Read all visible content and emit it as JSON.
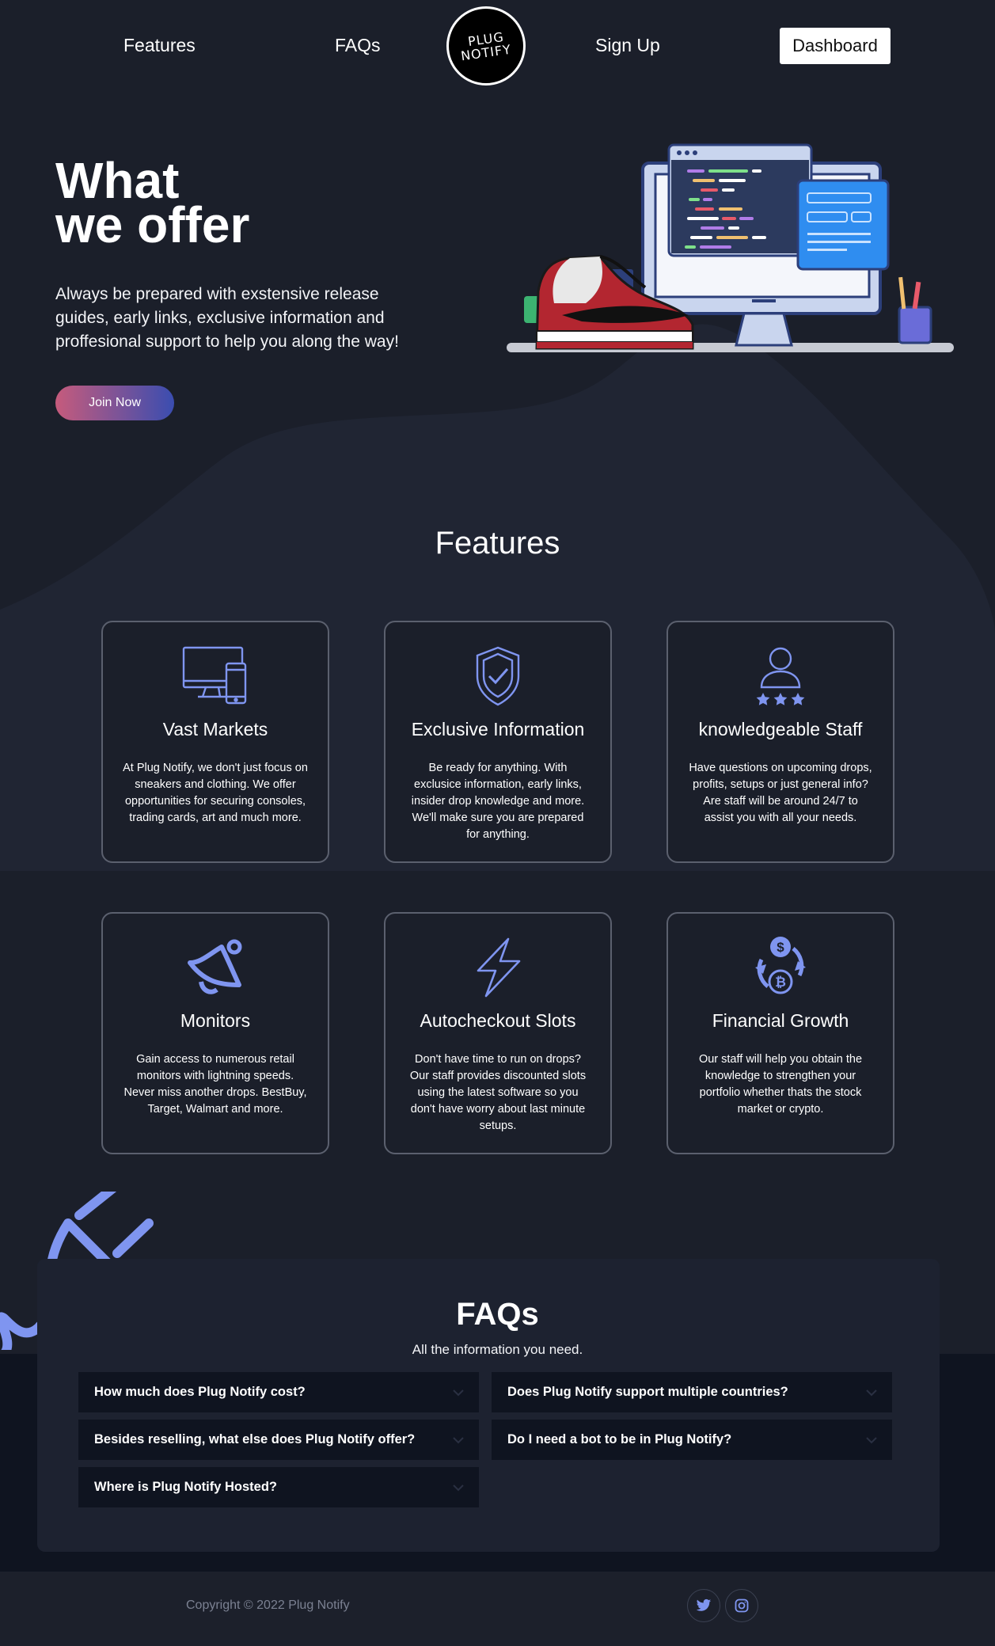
{
  "nav": {
    "features_label": "Features",
    "faqs_label": "FAQs",
    "logo_line1": "PLUG",
    "logo_line2": "NOTIFY",
    "signup_label": "Sign Up",
    "dashboard_label": "Dashboard"
  },
  "hero": {
    "title_line1": "What",
    "title_line2": "we offer",
    "text": "Always be prepared with exstensive release guides, early links, exclusive information and proffesional support to help you along the way!",
    "join_label": "Join Now"
  },
  "features": {
    "title": "Features",
    "cards": [
      {
        "icon": "devices-icon",
        "title": "Vast Markets",
        "text": "At Plug Notify, we don't just focus on sneakers and clothing. We offer opportunities for securing consoles, trading cards, art and much more."
      },
      {
        "icon": "shield-check-icon",
        "title": "Exclusive Information",
        "text": "Be ready for anything. With exclusice information, early links, insider drop knowledge and more. We'll make sure you are prepared for anything."
      },
      {
        "icon": "user-stars-icon",
        "title": "knowledgeable Staff",
        "text": "Have questions on upcoming drops, profits, setups or just general info? Are staff will be around 24/7 to assist you with all your needs."
      },
      {
        "icon": "bell-icon",
        "title": "Monitors",
        "text": "Gain access to numerous retail monitors with lightning speeds. Never miss another drops. BestBuy, Target, Walmart and more."
      },
      {
        "icon": "lightning-icon",
        "title": "Autocheckout Slots",
        "text": "Don't have time to run on drops? Our staff provides discounted slots using the latest software so you don't have worry about last minute setups."
      },
      {
        "icon": "currency-exchange-icon",
        "title": "Financial Growth",
        "text": "Our staff will help you obtain the knowledge to strengthen your portfolio whether thats the stock market or crypto."
      }
    ]
  },
  "faq": {
    "title": "FAQs",
    "subtitle": "All the information you need.",
    "items": [
      {
        "q": "How much does Plug Notify cost?"
      },
      {
        "q": "Does Plug Notify support multiple countries?"
      },
      {
        "q": "Besides reselling, what else does Plug Notify offer?"
      },
      {
        "q": "Do I need a bot to be in Plug Notify?"
      },
      {
        "q": "Where is Plug Notify Hosted?"
      }
    ]
  },
  "footer": {
    "copyright": "Copyright © 2022 Plug Notify",
    "social": [
      "twitter-icon",
      "instagram-icon"
    ]
  },
  "colors": {
    "background": "#1b1f2a",
    "accent": "#7f95f0",
    "faq_item_bg": "#0f1420",
    "card_border": "#5b606e"
  }
}
